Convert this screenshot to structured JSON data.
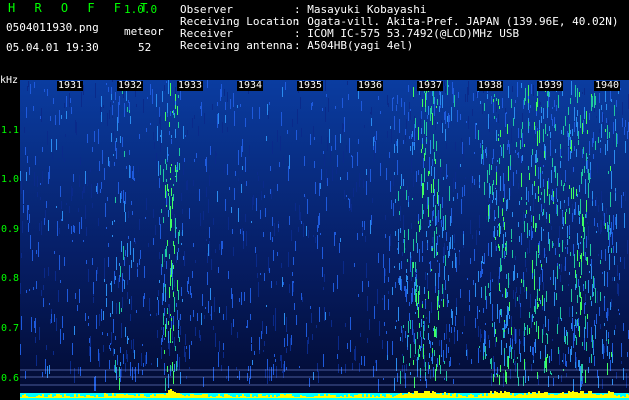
{
  "header": {
    "app_title": "H R O F F T",
    "version": "1.0.0",
    "filename": "0504011930.png",
    "meteor_label": "meteor",
    "datetime": "05.04.01 19:30",
    "meteor_count": "52"
  },
  "info": {
    "observer_label": "Observer",
    "observer_value": ": Masayuki Kobayashi",
    "location_label": "Receiving Location",
    "location_value": ": Ogata-vill. Akita-Pref. JAPAN (139.96E, 40.02N)",
    "receiver_label": "Receiver",
    "receiver_value": ": ICOM IC-575 53.7492(@LCD)MHz USB",
    "antenna_label": "Receiving antenna",
    "antenna_value": ": A504HB(yagi 4el)"
  },
  "axis": {
    "unit": "kHz",
    "freq_ticks": [
      "1.1",
      "1.0",
      "0.9",
      "0.8",
      "0.7",
      "0.6"
    ],
    "time_ticks": [
      "1931",
      "1932",
      "1933",
      "1934",
      "1935",
      "1936",
      "1937",
      "1938",
      "1939",
      "1940"
    ]
  },
  "colors": {
    "background": "#000000",
    "header_green": "#00ff00",
    "spectrum_low": "#000a3c",
    "spectrum_mid": "#1e5adc",
    "spectrum_high": "#00ff80",
    "strip_yellow": "#ffff00",
    "strip_cyan": "#00ffff"
  }
}
